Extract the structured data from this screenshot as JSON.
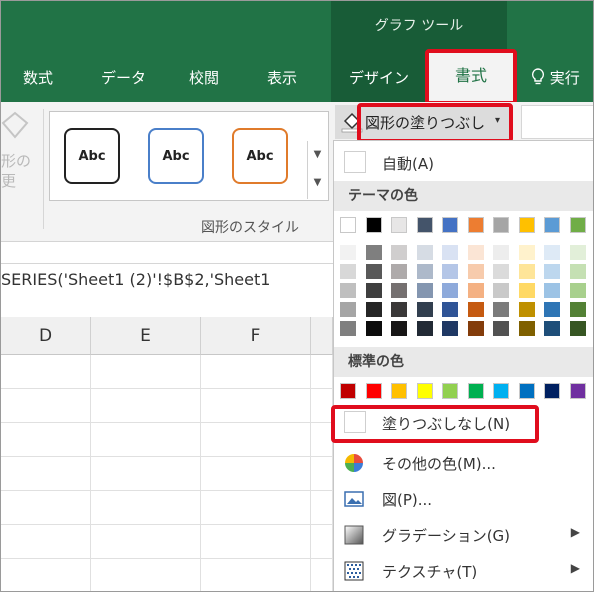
{
  "ribbon": {
    "context_title": "グラフ ツール",
    "tabs": [
      "数式",
      "データ",
      "校閲",
      "表示",
      "デザイン"
    ],
    "active_tab": "書式",
    "tell_me": "実行"
  },
  "left_faded": {
    "line1": "形の",
    "line2": "更"
  },
  "gallery": {
    "items": [
      "Abc",
      "Abc",
      "Abc"
    ],
    "group_label": "図形のスタイル",
    "colors": {
      "dark": "#222222",
      "blue": "#4a7fc9",
      "orange": "#e07b2b"
    }
  },
  "shape_fill_button": {
    "label": "図形の塗りつぶし",
    "caret": "▾"
  },
  "formula_bar": {
    "text": "SERIES('Sheet1 (2)'!$B$2,'Sheet1"
  },
  "columns": [
    "D",
    "E",
    "F"
  ],
  "menu": {
    "auto_label": "自動(A)",
    "theme_colors_title": "テーマの色",
    "standard_colors_title": "標準の色",
    "no_fill_label": "塗りつぶしなし(N)",
    "more_colors_label": "その他の色(M)...",
    "picture_label": "図(P)...",
    "gradient_label": "グラデーション(G)",
    "texture_label": "テクスチャ(T)",
    "submenu_arrow": "▶"
  },
  "theme_colors": {
    "top": [
      "#ffffff",
      "#000000",
      "#e7e6e6",
      "#44546a",
      "#4472c4",
      "#ed7d31",
      "#a5a5a5",
      "#ffc000",
      "#5b9bd5",
      "#70ad47"
    ],
    "shades": [
      [
        "#f2f2f2",
        "#7f7f7f",
        "#d0cece",
        "#d6dce4",
        "#d9e2f3",
        "#fbe5d5",
        "#ededed",
        "#fff2cc",
        "#deeaf6",
        "#e2efd9"
      ],
      [
        "#d8d8d8",
        "#595959",
        "#aeaaaa",
        "#adb9ca",
        "#b4c6e7",
        "#f7cbac",
        "#dbdbdb",
        "#fee599",
        "#bdd7ee",
        "#c5e0b3"
      ],
      [
        "#bfbfbf",
        "#3f3f3f",
        "#757070",
        "#8496b0",
        "#8eaadb",
        "#f4b183",
        "#c9c9c9",
        "#ffd965",
        "#9cc3e5",
        "#a8d08d"
      ],
      [
        "#a5a5a5",
        "#262626",
        "#3a3838",
        "#323f4f",
        "#2f5496",
        "#c55a11",
        "#7b7b7b",
        "#bf9000",
        "#2e75b5",
        "#538135"
      ],
      [
        "#7f7f7f",
        "#0c0c0c",
        "#171616",
        "#222a35",
        "#1f3864",
        "#833c0b",
        "#525252",
        "#7f6000",
        "#1e4e79",
        "#375623"
      ]
    ]
  },
  "standard_colors": [
    "#c00000",
    "#ff0000",
    "#ffc000",
    "#ffff00",
    "#92d050",
    "#00b050",
    "#00b0f0",
    "#0070c0",
    "#002060",
    "#7030a0"
  ]
}
